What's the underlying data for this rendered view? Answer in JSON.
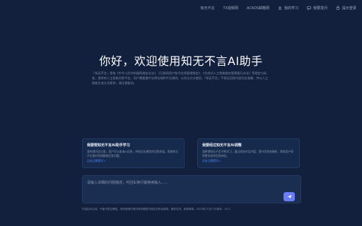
{
  "nav": {
    "items": [
      {
        "label": "知无不言",
        "icon": ""
      },
      {
        "label": "TX视频网",
        "icon": ""
      },
      {
        "label": "ACKOS邮箱网",
        "icon": ""
      },
      {
        "label": "我的学习",
        "icon": "download-icon"
      },
      {
        "label": "我要发问",
        "icon": "message-icon"
      },
      {
        "label": "提示登录",
        "icon": "lock-icon"
      }
    ]
  },
  "hero": {
    "title": "你好，欢迎使用知无不言AI助手",
    "intro": "「知无不言」是依《中华人民共和国网络安全法》、《互联网用户账号信息管理规定》、《生成式人工智能服务管理暂行办法》等规定与标准，提供的人工智能问答平台，用户需要遵守法律法规和平台规则，以合法方式使用。「知无不言」不保证回答内容完全准确，并以人工智能生成方式提供，请注意甄别。"
  },
  "cards": [
    {
      "title": "我要帮知无不言AI助手学习",
      "desc": "我的提问会记录，用户可以查询AI回答，持续优化模型的回答质量，帮助知无不言更好地理解和回答问题。",
      "link": "点击立即提问 »"
    },
    {
      "title": "我要经过知无不言AI调整",
      "desc": "我希望知无不言不断学习，通过改进对话内容，提升回答准确性，帮助用户获得更优质的回答体验。",
      "link": "点击立即提问 »"
    }
  ],
  "composer": {
    "placeholder": "请输入详细的问题描述，可回车换行键继续输入......",
    "send_icon": "send-icon"
  },
  "footer": {
    "text": "内容由AI生成，不能代表正确性。有效使用时请对其问题进行核实分析后使用。服务支持，免费使用。2023年11月27日版本：V2.0"
  },
  "colors": {
    "background": "#12203d",
    "accent": "#6a7cf6",
    "link": "#4c8dff"
  }
}
